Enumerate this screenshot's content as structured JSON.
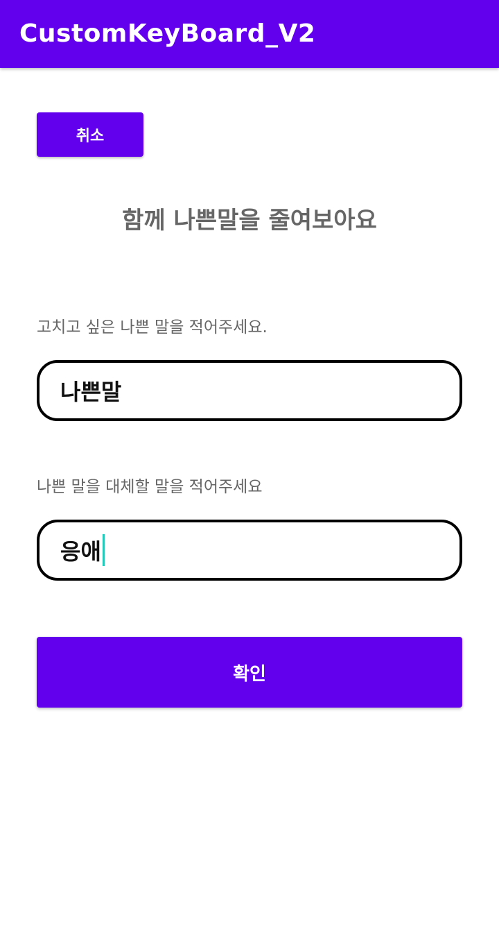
{
  "app_bar": {
    "title": "CustomKeyBoard_V2",
    "color": "#6200ee"
  },
  "cancel_button": {
    "label": "취소"
  },
  "page_title": "함께 나쁜말을 줄여보아요",
  "bad_word": {
    "label": "고치고 싶은 나쁜 말을 적어주세요.",
    "value": "나쁜말"
  },
  "replacement_word": {
    "label": "나쁜 말을 대체할 말을 적어주세요",
    "value": "응애"
  },
  "confirm_button": {
    "label": "확인"
  }
}
